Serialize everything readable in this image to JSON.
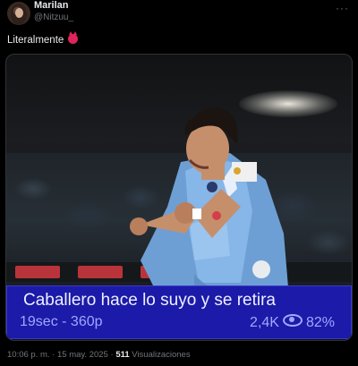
{
  "author": {
    "display_name": "Marilan",
    "handle": "@Nitzuu_",
    "avatar_icon": "avatar"
  },
  "tweet": {
    "text": "Literalmente",
    "emoji": "devil-face-emoji"
  },
  "media": {
    "caption_title": "Caballero hace lo suyo y se retira",
    "duration_quality": "19sec - 360p",
    "views": "2,4K",
    "percent": "82%",
    "accent_color": "#1c1aa8"
  },
  "footer": {
    "time": "10:06 p. m.",
    "separator": "·",
    "date": "15 may. 2025",
    "view_count": "511",
    "view_label": "Visualizaciones"
  },
  "menu": {
    "more_label": "···"
  }
}
